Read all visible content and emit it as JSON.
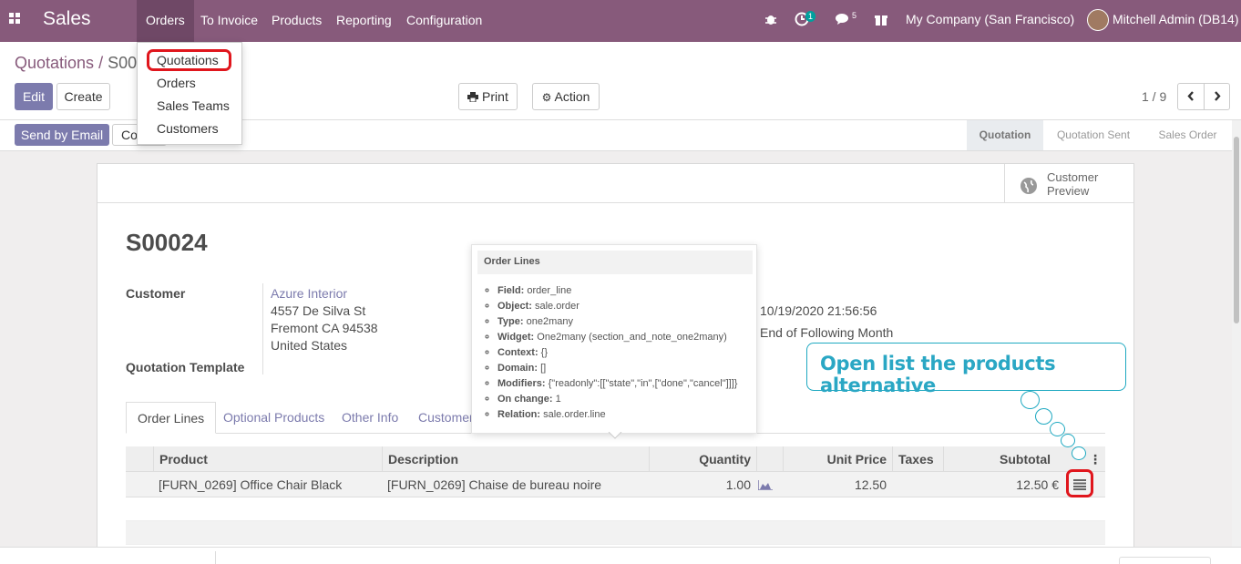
{
  "nav": {
    "brand": "Sales",
    "menus": [
      "Orders",
      "To Invoice",
      "Products",
      "Reporting",
      "Configuration"
    ],
    "activity_count": "1",
    "message_count": "5",
    "company": "My Company (San Francisco)",
    "user": "Mitchell Admin (DB14)"
  },
  "orders_menu": [
    "Quotations",
    "Orders",
    "Sales Teams",
    "Customers"
  ],
  "breadcrumb": {
    "parent": "Quotations",
    "sep": "/",
    "current": "S00"
  },
  "buttons": {
    "edit": "Edit",
    "create": "Create",
    "print": "Print",
    "action": "Action",
    "pager": "1 / 9",
    "send_email": "Send by Email",
    "confirm": "Co"
  },
  "stages": [
    "Quotation",
    "Quotation Sent",
    "Sales Order"
  ],
  "sheet": {
    "customer_preview": [
      "Customer",
      "Preview"
    ],
    "name": "S00024",
    "customer_label": "Customer",
    "customer": "Azure Interior",
    "address": [
      "4557 De Silva St",
      "Fremont CA 94538",
      "United States"
    ],
    "template_label": "Quotation Template",
    "date": "10/19/2020 21:56:56",
    "payment_terms": "End of Following Month",
    "tabs": [
      "Order Lines",
      "Optional Products",
      "Other Info",
      "Customer"
    ],
    "columns": [
      "Product",
      "Description",
      "Quantity",
      "Unit Price",
      "Taxes",
      "Subtotal"
    ],
    "rows": [
      {
        "product": "[FURN_0269] Office Chair Black",
        "description": "[FURN_0269] Chaise de bureau noire",
        "quantity": "1.00",
        "unit_price": "12.50",
        "subtotal": "12.50 €"
      }
    ]
  },
  "tooltip": {
    "title": "Order Lines",
    "items": [
      {
        "k": "Field:",
        "v": "order_line"
      },
      {
        "k": "Object:",
        "v": "sale.order"
      },
      {
        "k": "Type:",
        "v": "one2many"
      },
      {
        "k": "Widget:",
        "v": "One2many (section_and_note_one2many)"
      },
      {
        "k": "Context:",
        "v": "{}"
      },
      {
        "k": "Domain:",
        "v": "[]"
      },
      {
        "k": "Modifiers:",
        "v": "{\"readonly\":[[\"state\",\"in\",[\"done\",\"cancel\"]]]}"
      },
      {
        "k": "On change:",
        "v": "1"
      },
      {
        "k": "Relation:",
        "v": "sale.order.line"
      }
    ]
  },
  "callout": "Open list the products alternative",
  "colors": {
    "brand": "#875a7b",
    "primary": "#7c7bad",
    "callout": "#1fa9c1",
    "highlight": "#e0161d"
  }
}
